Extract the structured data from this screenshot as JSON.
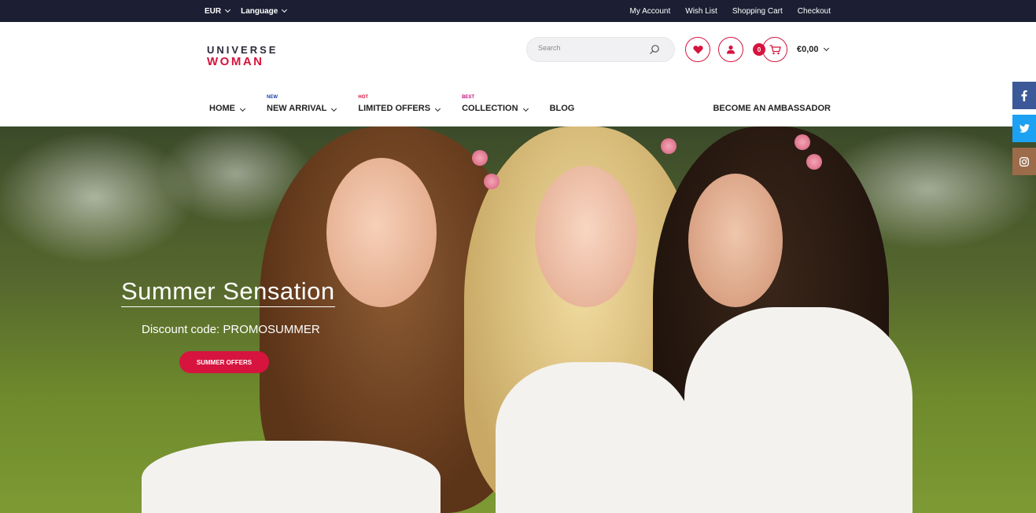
{
  "topbar": {
    "currency": "EUR",
    "language": "Language",
    "links": [
      "My Account",
      "Wish List",
      "Shopping Cart",
      "Checkout"
    ]
  },
  "header": {
    "logo_line1": "UNIVERSE",
    "logo_line2": "WOMAN",
    "search_placeholder": "Search",
    "cart_count": "0",
    "cart_total": "€0,00"
  },
  "nav": {
    "items": [
      {
        "label": "HOME",
        "tag": ""
      },
      {
        "label": "NEW ARRIVAL",
        "tag": "NEW"
      },
      {
        "label": "LIMITED OFFERS",
        "tag": "HOT"
      },
      {
        "label": "COLLECTION",
        "tag": "BEST"
      },
      {
        "label": "BLOG",
        "tag": ""
      }
    ],
    "ambassador": "BECOME AN AMBASSADOR"
  },
  "hero": {
    "title": "Summer Sensation",
    "subtitle": "Discount code: PROMOSUMMER",
    "button": "SUMMER OFFERS"
  },
  "colors": {
    "accent": "#d6143e",
    "topbar": "#1c1f33",
    "tag_new": "#1a3fa8",
    "tag_hot": "#d6143e",
    "tag_best": "#c2157a",
    "facebook": "#3b5998",
    "twitter": "#1da1f2",
    "instagram": "#9b6b4a"
  },
  "social": [
    "facebook-icon",
    "twitter-icon",
    "instagram-icon"
  ]
}
